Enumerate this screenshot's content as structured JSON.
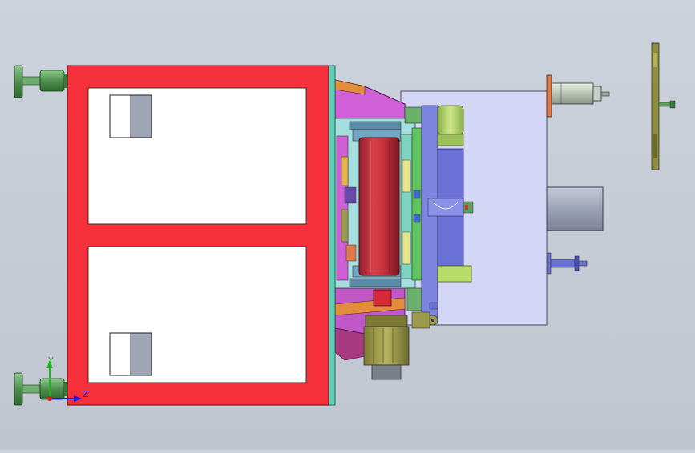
{
  "viewport": {
    "background_top": "#ccd3dc",
    "background_bottom": "#bfc6cf"
  },
  "triad": {
    "y_label": "Y",
    "z_label": "Z",
    "y_color": "#18b818",
    "z_color": "#1a1ad8",
    "x_color": "#d81a1a"
  },
  "colors": {
    "frame_red": "#f5303a",
    "panel_white": "#ffffff",
    "plate_lavender": "#d4d6f6",
    "roller_red": "#c8303c",
    "motor_olive": "#9c9a4c",
    "gear_lime": "#b8de6a",
    "bracket_magenta": "#d060d8",
    "cylinder_grey": "#aab0c4",
    "foot_green": "#5c9e5c",
    "rail_teal": "#7ed4c0",
    "block_blue": "#6a72d8"
  }
}
